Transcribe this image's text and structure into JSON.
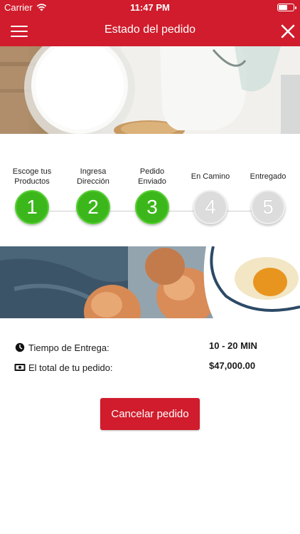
{
  "status_bar": {
    "carrier": "Carrier",
    "time": "11:47 PM",
    "battery_level": 0.65
  },
  "nav": {
    "title": "Estado del pedido",
    "menu_icon": "hamburger-icon",
    "close_icon": "close-icon"
  },
  "steps": [
    {
      "label": "Escoge tus Productos",
      "number": "1",
      "state": "done"
    },
    {
      "label": "Ingresa Dirección",
      "number": "2",
      "state": "done"
    },
    {
      "label": "Pedido Enviado",
      "number": "3",
      "state": "done"
    },
    {
      "label": "En Camino",
      "number": "4",
      "state": "pending"
    },
    {
      "label": "Entregado",
      "number": "5",
      "state": "pending"
    }
  ],
  "order_info": {
    "delivery_label": "Tiempo de Entrega:",
    "delivery_value": "10 - 20 MIN",
    "delivery_icon": "clock-icon",
    "total_label": "El total de tu pedido:",
    "total_value": "$47,000.00",
    "total_icon": "money-icon"
  },
  "actions": {
    "cancel_label": "Cancelar pedido"
  },
  "colors": {
    "brand_red": "#d01c2c",
    "step_done": "#3bb71b",
    "step_pending": "#dcdcdc"
  }
}
